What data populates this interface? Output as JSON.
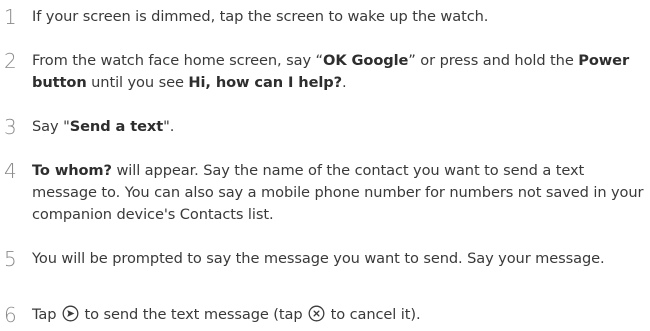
{
  "steps": [
    {
      "num": "1",
      "parts": [
        {
          "t": "If your screen is dimmed, tap the screen to wake up the watch."
        }
      ]
    },
    {
      "num": "2",
      "parts": [
        {
          "t": "From the watch face home screen, say “"
        },
        {
          "t": "OK Google",
          "b": true
        },
        {
          "t": "” or press and hold the "
        },
        {
          "t": "Power button",
          "b": true
        },
        {
          "t": " until you see "
        },
        {
          "t": "Hi, how can I help?",
          "b": true
        },
        {
          "t": "."
        }
      ]
    },
    {
      "num": "3",
      "parts": [
        {
          "t": "Say \""
        },
        {
          "t": "Send a text",
          "b": true
        },
        {
          "t": "\"."
        }
      ]
    },
    {
      "num": "4",
      "parts": [
        {
          "t": "To whom?",
          "b": true
        },
        {
          "t": " will appear. Say the name of the contact you want to send a text message to. You can also say a mobile phone number for numbers not saved in your companion device's Contacts list."
        }
      ]
    },
    {
      "num": "5",
      "parts": [
        {
          "t": "You will be prompted to say the message you want to send. Say your message."
        }
      ]
    },
    {
      "num": "6",
      "parts": [
        {
          "t": "Tap "
        },
        {
          "icon": "send-icon"
        },
        {
          "t": " to send the text message (tap "
        },
        {
          "icon": "cancel-icon"
        },
        {
          "t": " to cancel it)."
        }
      ]
    }
  ]
}
